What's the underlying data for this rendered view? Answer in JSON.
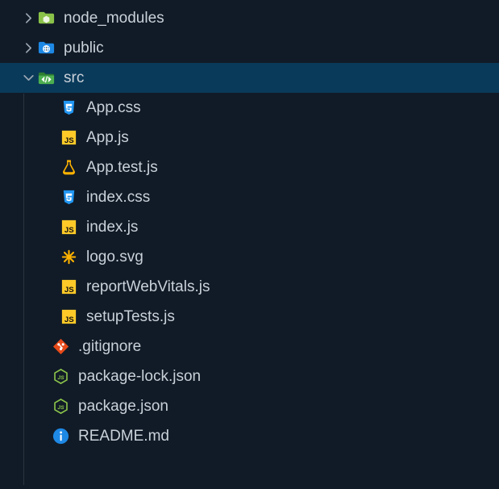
{
  "tree": [
    {
      "name": "node_modules",
      "type": "folder",
      "icon": "folder-node",
      "expanded": false,
      "depth": 0
    },
    {
      "name": "public",
      "type": "folder",
      "icon": "folder-public",
      "expanded": false,
      "depth": 0
    },
    {
      "name": "src",
      "type": "folder",
      "icon": "folder-src",
      "expanded": true,
      "depth": 0,
      "selected": true
    },
    {
      "name": "App.css",
      "type": "file",
      "icon": "css",
      "depth": 2
    },
    {
      "name": "App.js",
      "type": "file",
      "icon": "js",
      "depth": 2
    },
    {
      "name": "App.test.js",
      "type": "file",
      "icon": "test",
      "depth": 2
    },
    {
      "name": "index.css",
      "type": "file",
      "icon": "css",
      "depth": 2
    },
    {
      "name": "index.js",
      "type": "file",
      "icon": "js",
      "depth": 2
    },
    {
      "name": "logo.svg",
      "type": "file",
      "icon": "svg",
      "depth": 2
    },
    {
      "name": "reportWebVitals.js",
      "type": "file",
      "icon": "js",
      "depth": 2
    },
    {
      "name": "setupTests.js",
      "type": "file",
      "icon": "js",
      "depth": 2
    },
    {
      "name": ".gitignore",
      "type": "file",
      "icon": "git",
      "depth": 1
    },
    {
      "name": "package-lock.json",
      "type": "file",
      "icon": "node-json",
      "depth": 1
    },
    {
      "name": "package.json",
      "type": "file",
      "icon": "node-json",
      "depth": 1
    },
    {
      "name": "README.md",
      "type": "file",
      "icon": "readme",
      "depth": 1
    }
  ],
  "colors": {
    "bg": "#111b27",
    "selected": "#0a3a5a",
    "text": "#c9d1d9"
  }
}
